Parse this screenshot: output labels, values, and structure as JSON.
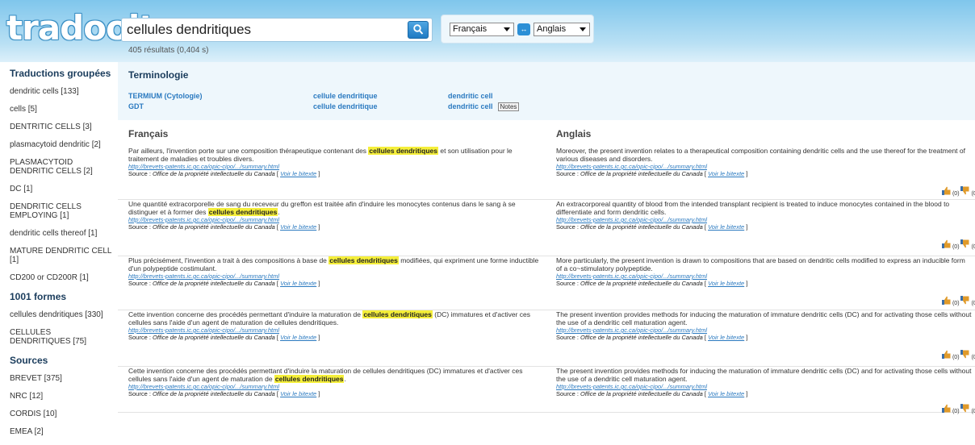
{
  "logo": "tradooit",
  "search": {
    "value": "cellules dendritiques",
    "results": "405 résultats (0,404 s)"
  },
  "languages": {
    "source": "Français",
    "target": "Anglais",
    "swap": "↔"
  },
  "sidebar": {
    "groups_title": "Traductions groupées",
    "groups": [
      "dendritic cells [133]",
      "cells [5]",
      "DENTRITIC CELLS [3]",
      "plasmacytoid dendritic [2]",
      "PLASMACYTOID DENDRITIC CELLS [2]",
      "DC [1]",
      "DENDRITIC CELLS EMPLOYING [1]",
      "dendritic cells thereof [1]",
      "MATURE DENDRITIC CELL [1]",
      "CD200 or CD200R [1]"
    ],
    "forms_title": "1001 formes",
    "forms": [
      "cellules dendritiques [330]",
      "CELLULES DENDRITIQUES [75]"
    ],
    "sources_title": "Sources",
    "sources": [
      "BREVET [375]",
      "NRC [12]",
      "CORDIS [10]",
      "EMEA [2]"
    ]
  },
  "terminology": {
    "title": "Terminologie",
    "rows": [
      {
        "source": "TERMIUM (Cytologie)",
        "fr": "cellule dendritique",
        "en": "dendritic cell",
        "notes": ""
      },
      {
        "source": "GDT",
        "fr": "cellule dendritique",
        "en": "dendritic cell",
        "notes": "Notes"
      }
    ]
  },
  "columns": {
    "fr": "Français",
    "en": "Anglais"
  },
  "common": {
    "url": "http://brevets-patents.ic.gc.ca/opic-cipo/.../summary.html",
    "source_label": "Source :",
    "source_name": "Office de la propriété intellectuelle du Canada",
    "bitext_link": "Voir le bitexte",
    "vote_count": "(0)"
  },
  "rows": [
    {
      "fr_before": "Par ailleurs, l'invention porte sur une composition thérapeutique contenant des ",
      "fr_hit": "cellules dendritiques",
      "fr_after": " et son utilisation pour le traitement de maladies et troubles divers.",
      "en": "Moreover, the present invention relates to a therapeutical composition containing dendritic cells and the use thereof for the treatment of various diseases and disorders."
    },
    {
      "fr_before": "Une quantité extracorporelle de sang du receveur du greffon est traitée afin d'induire les monocytes contenus dans le sang à se distinguer et à former des ",
      "fr_hit": "cellules dendritiques",
      "fr_after": ".",
      "en": "An extracorporeal quantity of blood from the intended transplant recipient is treated to induce monocytes contained in the blood to differentiate and form dendritic cells."
    },
    {
      "fr_before": "Plus précisément, l'invention a trait à des compositions à base de ",
      "fr_hit": "cellules dendritiques",
      "fr_after": " modifiées, qui expriment une forme inductible d'un polypeptide costimulant.",
      "en": "More particularly, the present invention is drawn to compositions that are based on dendritic cells modified to express an inducible form of a co~stimulatory polypeptide."
    },
    {
      "fr_before": "Cette invention concerne des procédés permettant d'induire la maturation de ",
      "fr_hit": "cellules dendritiques",
      "fr_after": " (DC) immatures et d'activer ces cellules sans l'aide d'un agent de maturation de cellules dendritiques.",
      "en": "The present invention provides methods for inducing the maturation of immature dendritic cells (DC) and for activating those cells without the use of a dendritic cell maturation agent."
    },
    {
      "fr_before": "Cette invention concerne des procédés permettant d'induire la maturation de cellules dendritiques (DC) immatures et d'activer ces cellules sans l'aide d'un agent de maturation de ",
      "fr_hit": "cellules dendritiques",
      "fr_after": ".",
      "en": "The present invention provides methods for inducing the maturation of immature dendritic cells (DC) and for activating those cells without the use of a dendritic cell maturation agent."
    }
  ]
}
